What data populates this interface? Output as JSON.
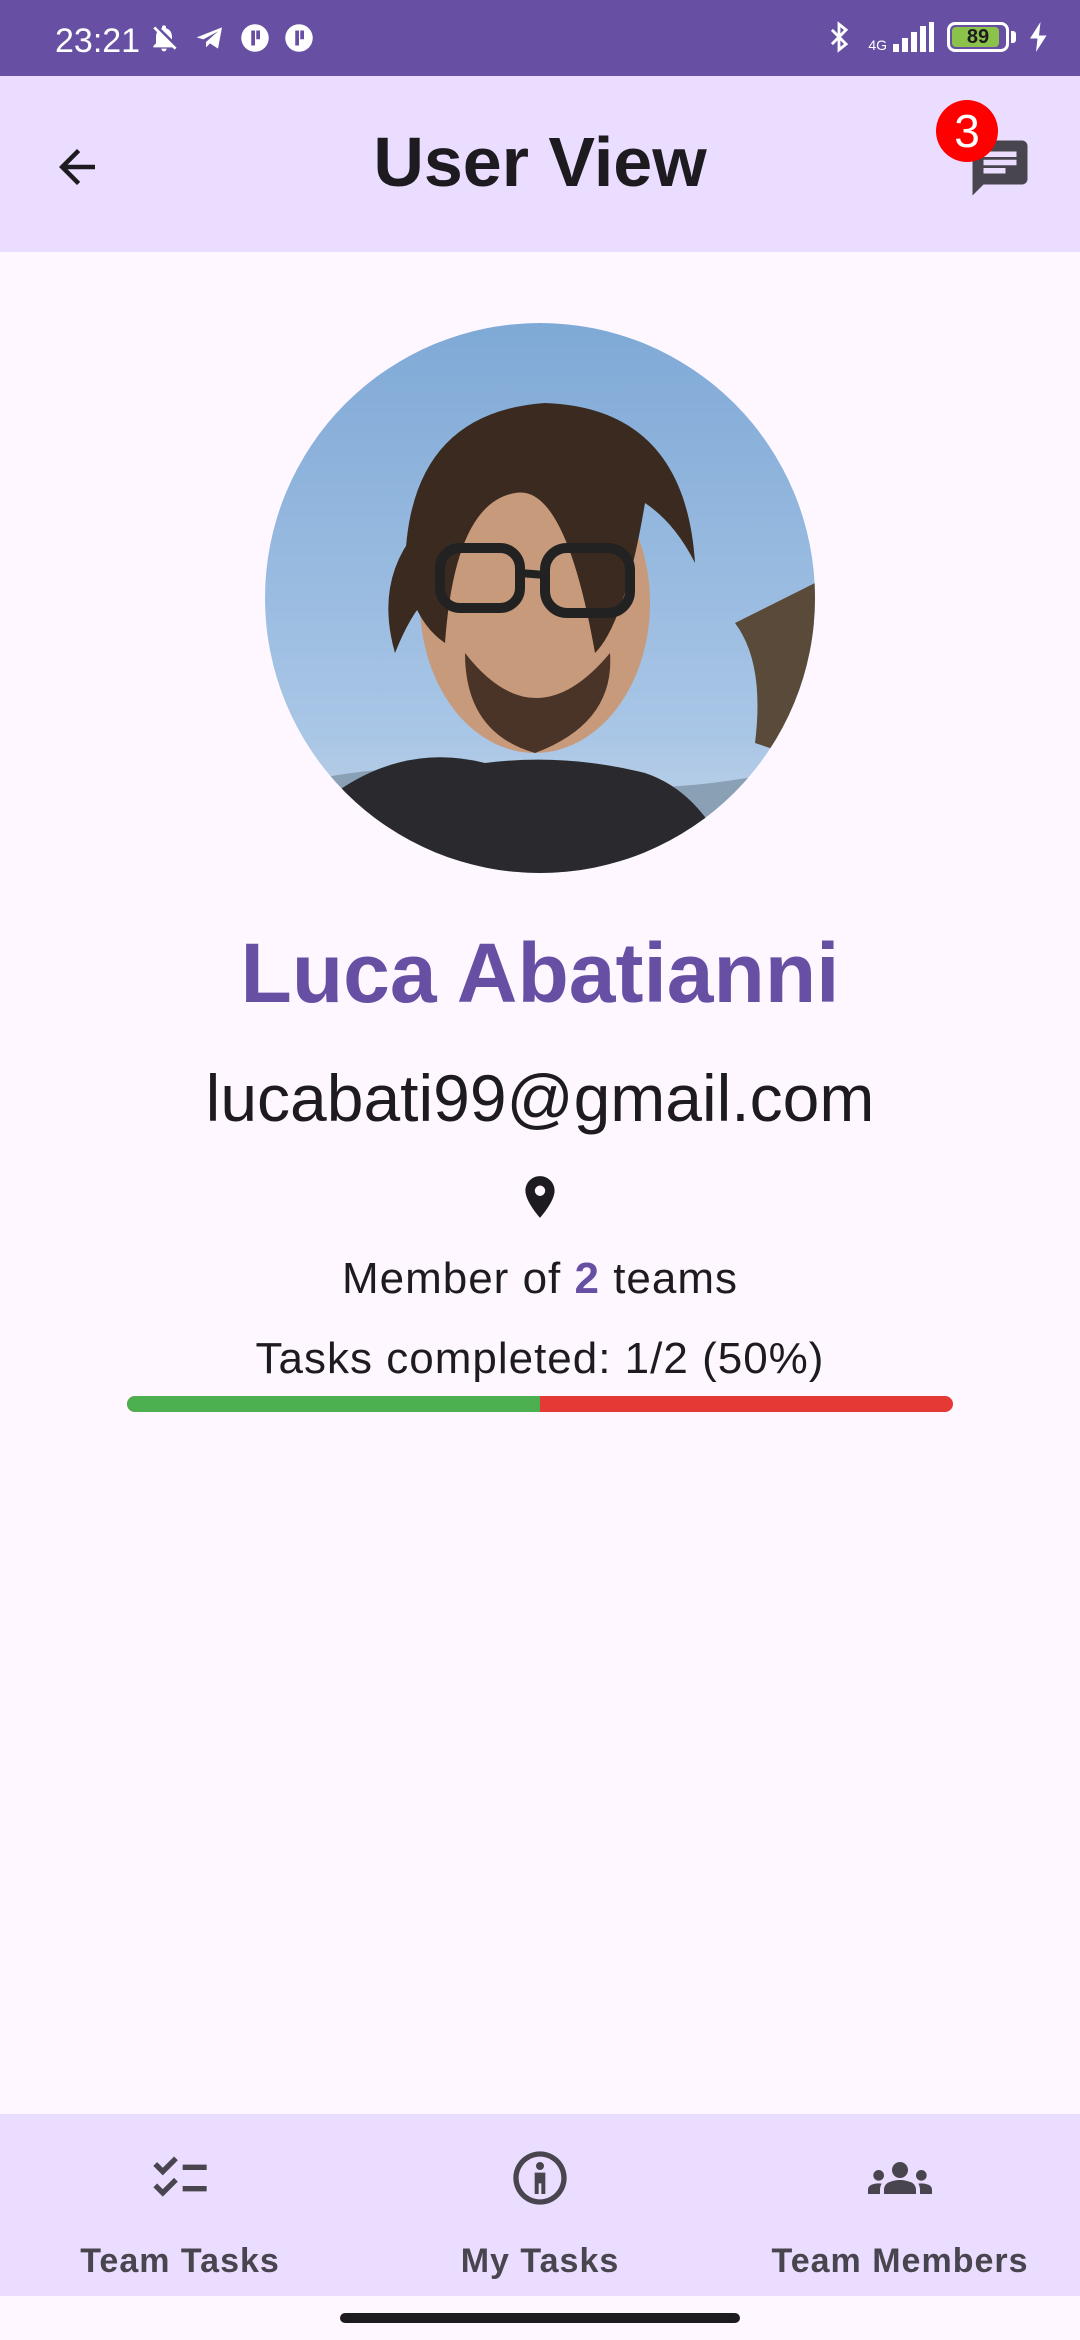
{
  "status_bar": {
    "time": "23:21",
    "left_icons": [
      "bell-off-icon",
      "telegram-icon",
      "app-icon",
      "app-icon"
    ],
    "network": "4G",
    "battery_level": "89"
  },
  "app_bar": {
    "title": "User View",
    "back_icon": "arrow-back-icon",
    "chat_icon": "chat-icon",
    "chat_badge": "3"
  },
  "profile": {
    "name": "Luca Abatianni",
    "email": "lucabati99@gmail.com",
    "location_icon": "location-pin-icon",
    "member_prefix": "Member of ",
    "team_count": "2",
    "member_suffix": " teams",
    "tasks_text": "Tasks completed: 1/2 (50%)",
    "tasks_completed_fraction": 0.5
  },
  "bottom_nav": {
    "items": [
      {
        "label": "Team Tasks",
        "icon": "checklist-icon"
      },
      {
        "label": "My Tasks",
        "icon": "person-outline-icon"
      },
      {
        "label": "Team Members",
        "icon": "group-icon"
      }
    ]
  },
  "colors": {
    "primary": "#6750a4",
    "app_bar_bg": "#eaddff",
    "progress_done": "#4caf50",
    "progress_remaining": "#e53935",
    "badge": "#ff0000"
  }
}
